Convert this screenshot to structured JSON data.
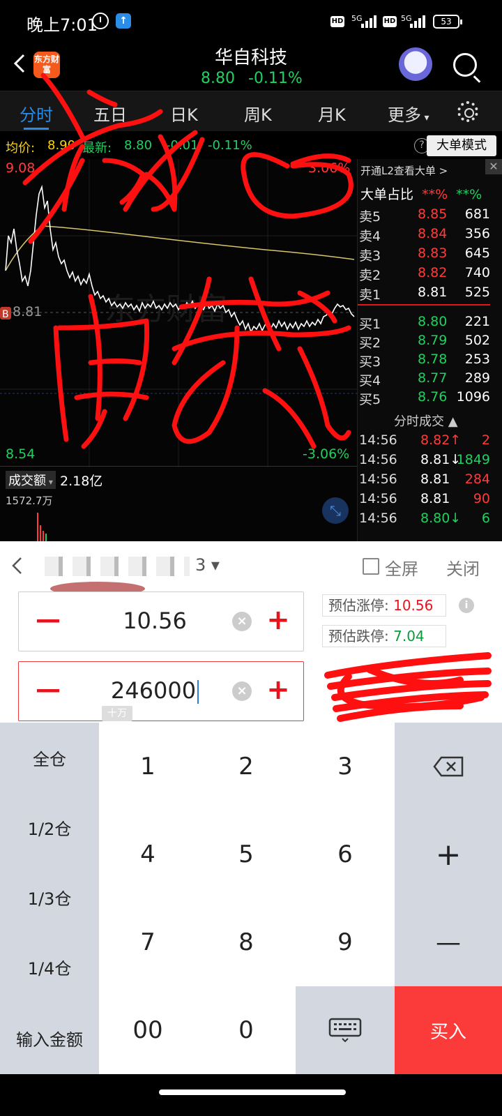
{
  "status": {
    "time": "晚上7:01",
    "net1": "5G",
    "net2": "5G",
    "hd1": "HD",
    "hd2": "HD",
    "battery": "53"
  },
  "header": {
    "logo_text": "东方财富",
    "stock_name": "华自科技",
    "price": "8.80",
    "change_pct": "-0.11%"
  },
  "tabs": [
    "分时",
    "五日",
    "日K",
    "周K",
    "月K",
    "更多"
  ],
  "info_line": {
    "avg_label": "均价:",
    "avg_value": "8.90",
    "latest_label": "最新:",
    "latest_value": "8.80",
    "change": "-0.01",
    "change_pct": "-0.11%",
    "help": "?",
    "mode_button": "大单模式"
  },
  "chart": {
    "high_price": "9.08",
    "high_pct": "3.06%",
    "mid_price": "8.81",
    "low_price": "8.54",
    "low_pct": "-3.06%",
    "marker": "B",
    "watermark": "东方财富"
  },
  "volume": {
    "label": "成交额",
    "value": "2.18亿",
    "max": "1572.7万"
  },
  "order_book": {
    "banner": "开通L2查看大单 >",
    "close": "✕",
    "ratio_label": "大单占比",
    "ratio_red": "**%",
    "ratio_green": "**%",
    "asks": [
      {
        "label": "卖5",
        "price": "8.85",
        "volume": "681",
        "color": "#ff3b3b"
      },
      {
        "label": "卖4",
        "price": "8.84",
        "volume": "356",
        "color": "#ff3b3b"
      },
      {
        "label": "卖3",
        "price": "8.83",
        "volume": "645",
        "color": "#ff3b3b"
      },
      {
        "label": "卖2",
        "price": "8.82",
        "volume": "740",
        "color": "#ff3b3b"
      },
      {
        "label": "卖1",
        "price": "8.81",
        "volume": "525",
        "color": "#ffffff"
      }
    ],
    "bids": [
      {
        "label": "买1",
        "price": "8.80",
        "volume": "221",
        "color": "#1fd15f"
      },
      {
        "label": "买2",
        "price": "8.79",
        "volume": "502",
        "color": "#1fd15f"
      },
      {
        "label": "买3",
        "price": "8.78",
        "volume": "253",
        "color": "#1fd15f"
      },
      {
        "label": "买4",
        "price": "8.77",
        "volume": "289",
        "color": "#1fd15f"
      },
      {
        "label": "买5",
        "price": "8.76",
        "volume": "1096",
        "color": "#1fd15f"
      }
    ],
    "ticks_title": "分时成交 ▲",
    "ticks": [
      {
        "time": "14:56",
        "price": "8.82↑",
        "volume": "2",
        "pcolor": "#ff3b3b",
        "vcolor": "#ff3b3b"
      },
      {
        "time": "14:56",
        "price": "8.81↓",
        "volume": "1849",
        "pcolor": "#ffffff",
        "vcolor": "#1fd15f"
      },
      {
        "time": "14:56",
        "price": "8.81",
        "volume": "284",
        "pcolor": "#ffffff",
        "vcolor": "#ff3b3b"
      },
      {
        "time": "14:56",
        "price": "8.81",
        "volume": "90",
        "pcolor": "#ffffff",
        "vcolor": "#ff3b3b"
      },
      {
        "time": "14:56",
        "price": "8.80↓",
        "volume": "6",
        "pcolor": "#1fd15f",
        "vcolor": "#1fd15f"
      }
    ]
  },
  "panel": {
    "account_suffix": "3 ▾",
    "fullscreen": "全屏",
    "close": "关闭",
    "price_value": "10.56",
    "quantity_value": "246000",
    "unit_hint": "十万",
    "limit_up_label": "预估涨停:",
    "limit_up_value": "10.56",
    "limit_down_label": "预估跌停:",
    "limit_down_value": "7.04"
  },
  "keypad": {
    "side": [
      "全仓",
      "1/2仓",
      "1/3仓",
      "1/4仓",
      "输入金额"
    ],
    "digits": [
      "1",
      "2",
      "3",
      "4",
      "5",
      "6",
      "7",
      "8",
      "9",
      "00",
      "0"
    ],
    "plus": "+",
    "minus": "—",
    "buy": "买入"
  },
  "colors": {
    "up": "#ff3b3b",
    "down": "#1fd15f",
    "accent": "#2a8be8",
    "buy": "#fb3a3a",
    "scribble": "#ff1010"
  }
}
